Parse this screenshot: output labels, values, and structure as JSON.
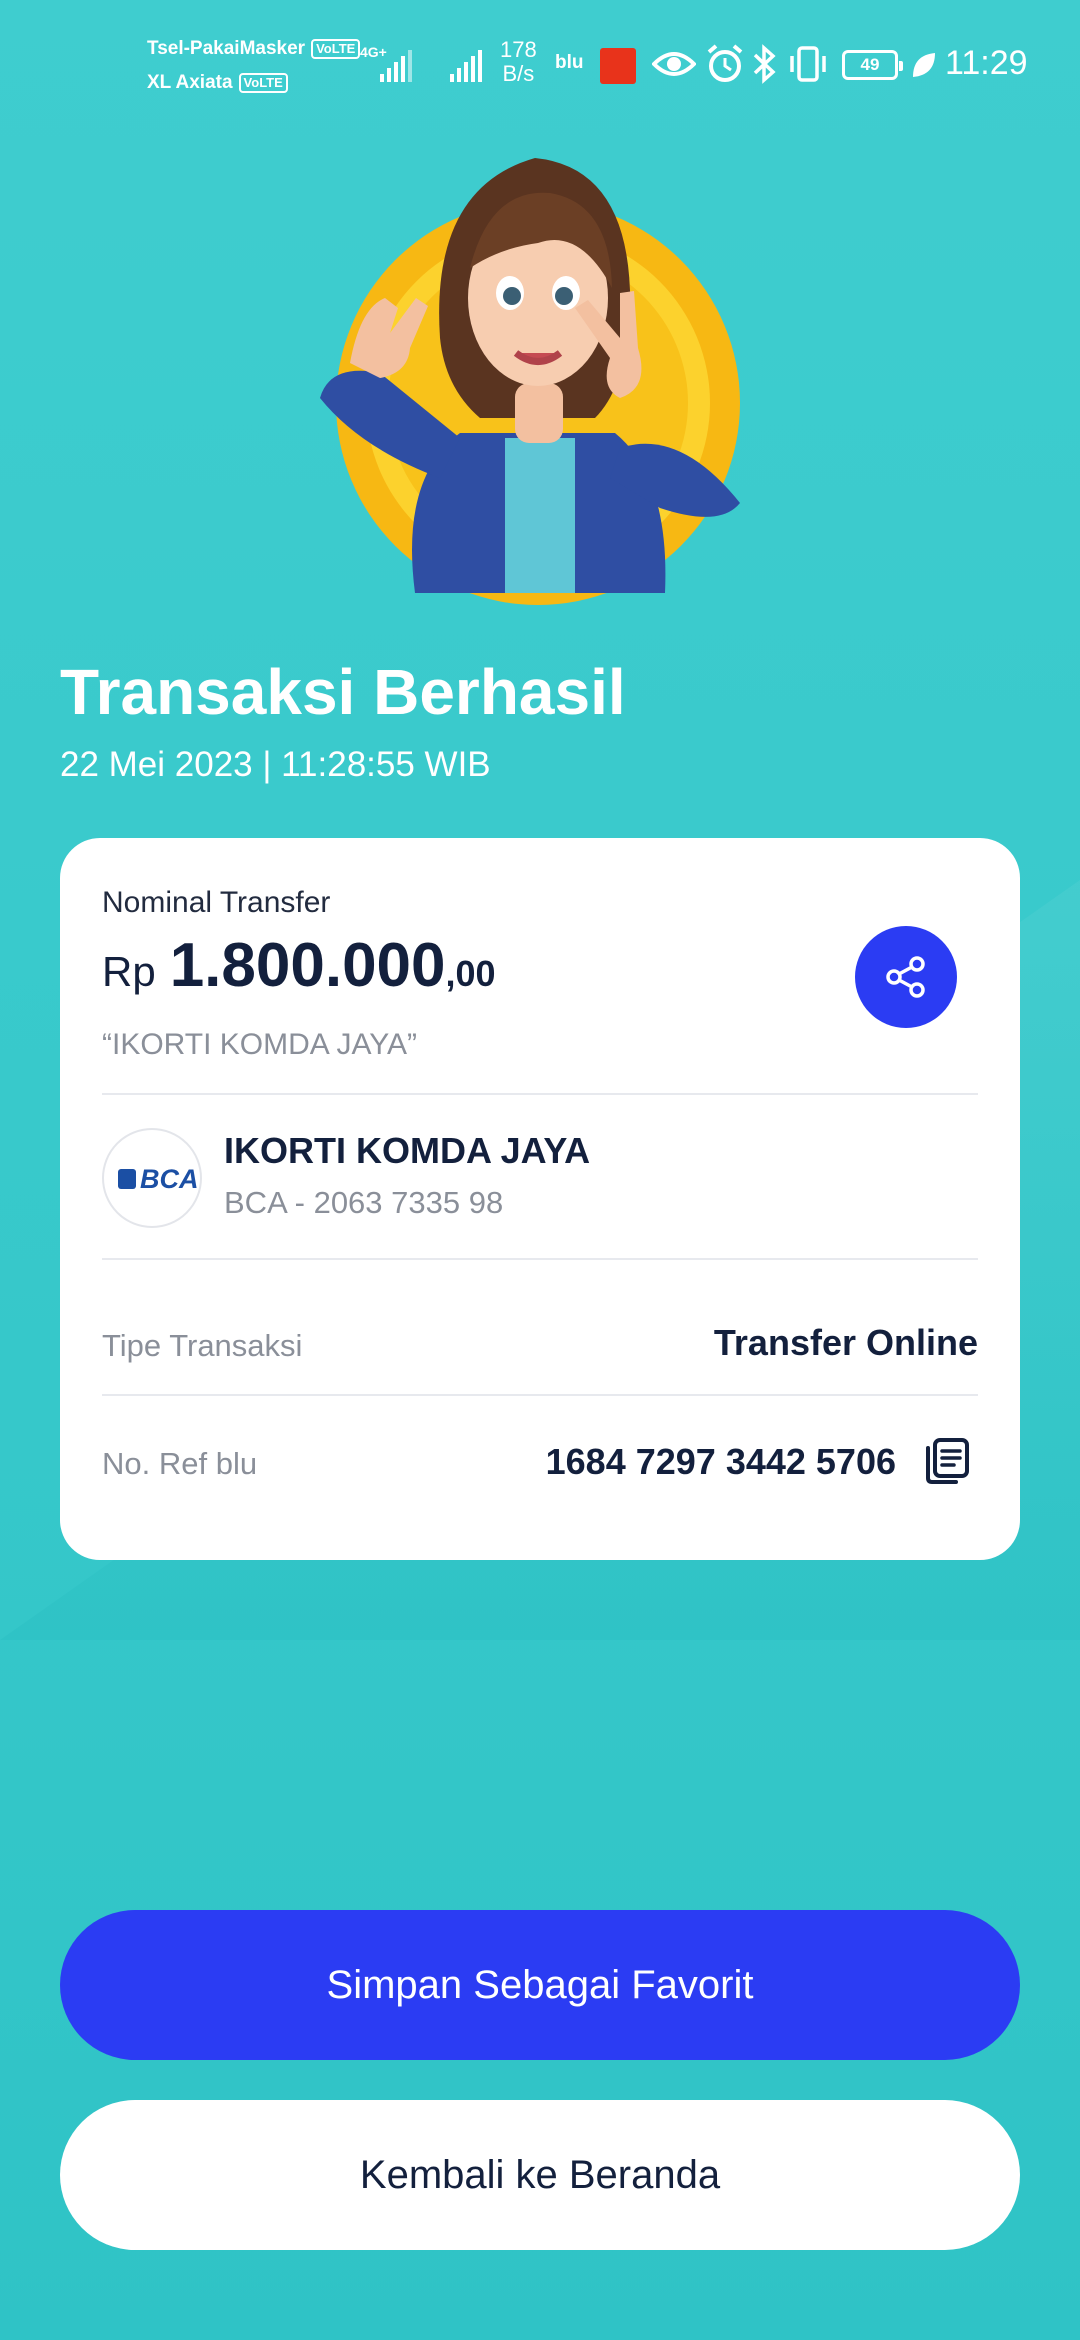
{
  "status_bar": {
    "carrier1": "Tsel-PakaiMasker",
    "carrier2": "XL Axiata",
    "volte": "VoLTE",
    "network": "4G+",
    "speed_value": "178",
    "speed_unit": "B/s",
    "blu_label": "blu",
    "battery": "49",
    "time": "11:29",
    "icons": [
      "eye-icon",
      "alarm-icon",
      "bluetooth-icon",
      "vibrate-icon",
      "leaf-icon"
    ]
  },
  "header": {
    "title": "Transaksi Berhasil",
    "datetime": "22 Mei 2023  |  11:28:55 WIB"
  },
  "transfer": {
    "label": "Nominal Transfer",
    "currency": "Rp",
    "amount": "1.800.000",
    "decimals": ",00",
    "note": "“IKORTI KOMDA JAYA”"
  },
  "recipient": {
    "bank_logo_text": "BCA",
    "name": "IKORTI KOMDA JAYA",
    "account": "BCA - 2063 7335 98"
  },
  "details": {
    "type_label": "Tipe Transaksi",
    "type_value": "Transfer Online",
    "ref_label": "No. Ref blu",
    "ref_value": "1684 7297 3442 5706"
  },
  "buttons": {
    "favorite": "Simpan Sebagai Favorit",
    "home": "Kembali ke Beranda"
  },
  "colors": {
    "background": "#3ecccf",
    "primary_blue": "#2b3cf3",
    "text_dark": "#13203d",
    "text_muted": "#8a8f99",
    "coin_yellow": "#f8c21a"
  }
}
